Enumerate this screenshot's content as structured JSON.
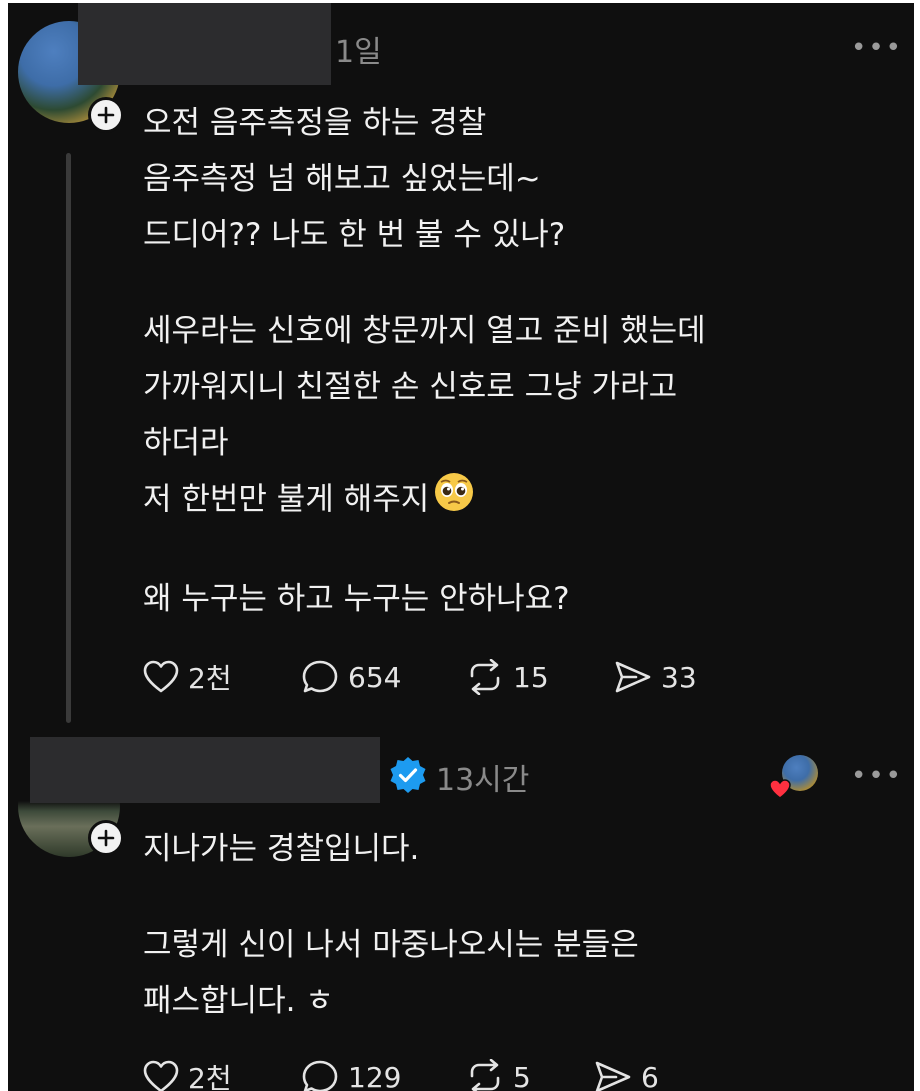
{
  "post1": {
    "time": "1일",
    "more_label": "•••",
    "lines_block1": [
      "오전 음주측정을 하는 경찰",
      "음주측정 넘 해보고 싶었는데~",
      "드디어?? 나도 한 번 불 수 있나?"
    ],
    "lines_block2": [
      "세우라는 신호에 창문까지 열고 준비 했는데",
      "가까워지니 친절한 손 신호로 그냥 가라고",
      "하더라",
      "저 한번만 불게 해주지"
    ],
    "lines_block3": [
      "왜 누구는 하고 누구는 안하나요?"
    ],
    "likes": "2천",
    "comments": "654",
    "reposts": "15",
    "shares": "33",
    "emoji": "pleading-face"
  },
  "post2": {
    "time": "13시간",
    "more_label": "•••",
    "verified": true,
    "lines_block1": [
      "지나가는 경찰입니다."
    ],
    "lines_block2": [
      "그렇게 신이 나서 마중나오시는 분들은",
      "패스합니다. ㅎ"
    ],
    "likes": "2천",
    "comments": "129",
    "reposts": "5",
    "shares": "6"
  },
  "colors": {
    "background": "#0f0f0f",
    "text": "#f1f1f1",
    "muted": "#8a8a8a",
    "verified": "#1d9bf0",
    "heart": "#ff3040"
  }
}
